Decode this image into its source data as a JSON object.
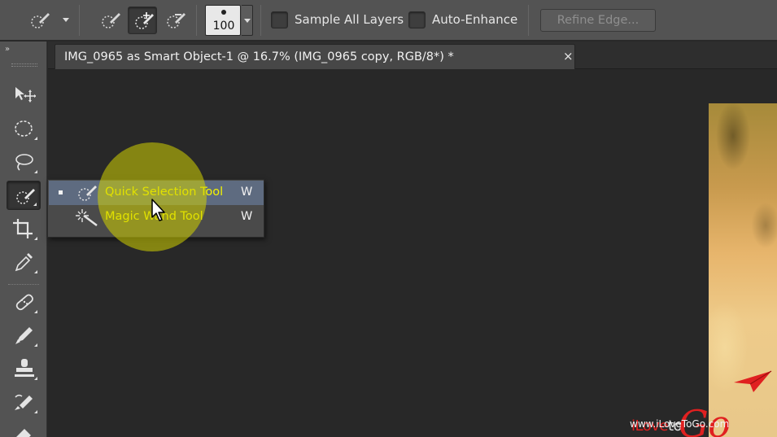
{
  "options_bar": {
    "brush_size": "100",
    "sample_all_layers_label": "Sample All Layers",
    "sample_all_layers_checked": false,
    "auto_enhance_label": "Auto-Enhance",
    "auto_enhance_checked": false,
    "refine_edge_label": "Refine Edge..."
  },
  "toolbar": {
    "collapse_label": "»",
    "tools": [
      {
        "name": "move",
        "icon": "move-tool-icon"
      },
      {
        "name": "marquee",
        "icon": "elliptical-marquee-icon"
      },
      {
        "name": "lasso",
        "icon": "lasso-icon"
      },
      {
        "name": "quick-selection",
        "icon": "quick-selection-icon",
        "active": true
      },
      {
        "name": "crop",
        "icon": "crop-icon"
      },
      {
        "name": "eyedropper",
        "icon": "eyedropper-icon"
      },
      {
        "name": "healing",
        "icon": "healing-brush-icon"
      },
      {
        "name": "brush",
        "icon": "brush-icon"
      },
      {
        "name": "clone-stamp",
        "icon": "clone-stamp-icon"
      },
      {
        "name": "history-brush",
        "icon": "history-brush-icon"
      },
      {
        "name": "eraser",
        "icon": "eraser-icon"
      }
    ]
  },
  "document": {
    "tab_title": "IMG_0965 as Smart Object-1 @ 16.7% (IMG_0965 copy, RGB/8*) *",
    "close_glyph": "×"
  },
  "flyout": {
    "items": [
      {
        "label": "Quick Selection Tool",
        "shortcut": "W",
        "selected": true
      },
      {
        "label": "Magic Wand Tool",
        "shortcut": "W",
        "selected": false
      }
    ]
  },
  "watermark": {
    "brand_prefix": "iLove",
    "brand_to": "to",
    "brand_go": "Go",
    "url": "www.iLoveToGo.com"
  },
  "colors": {
    "panel": "#535353",
    "canvas": "#282828",
    "flyout_highlight": "#5e6b80",
    "flyout_text": "#f4f400",
    "brand_red": "#e02020"
  }
}
